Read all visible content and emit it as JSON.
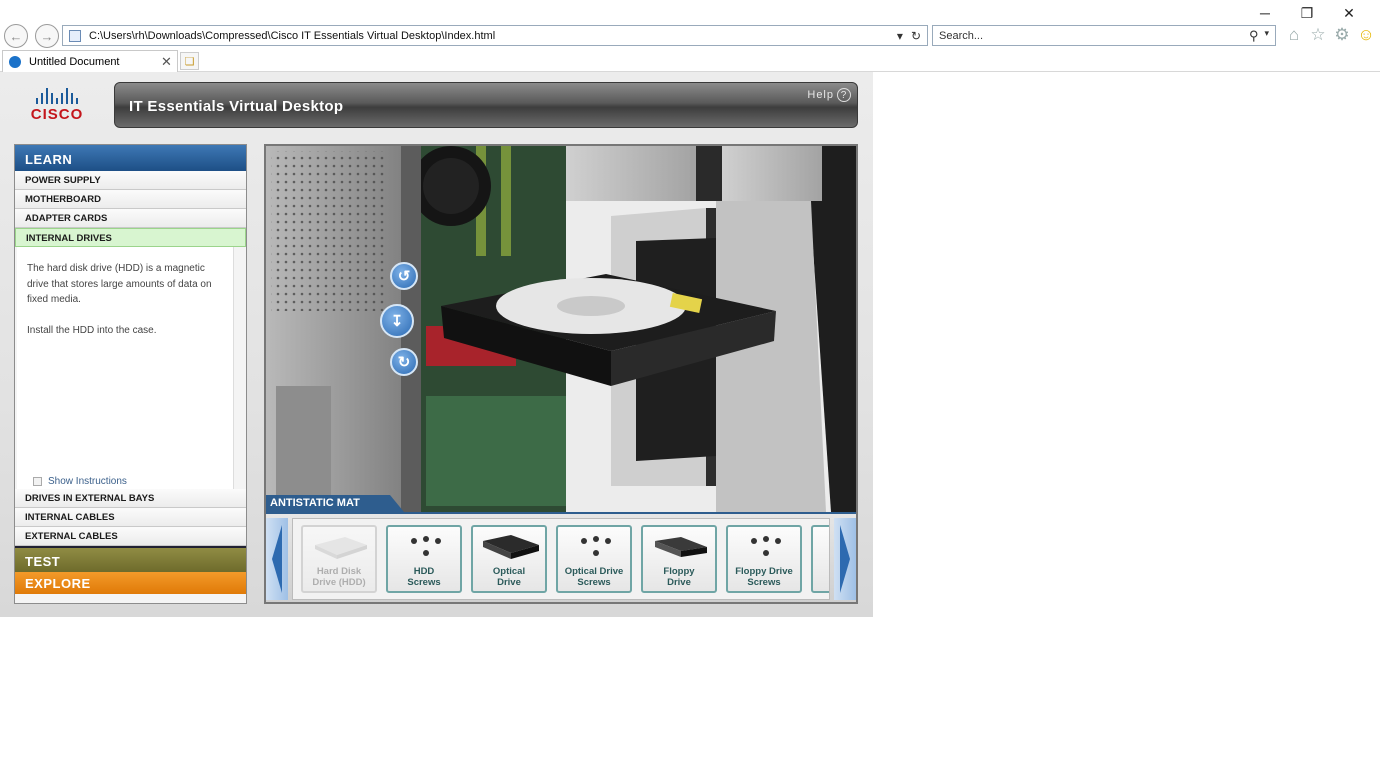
{
  "browser": {
    "window_controls": {
      "minimize": "─",
      "restore": "❐",
      "close": "✕"
    },
    "address": "C:\\Users\\rh\\Downloads\\Compressed\\Cisco IT Essentials Virtual Desktop\\Index.html",
    "search_placeholder": "Search...",
    "tab_title": "Untitled Document",
    "icons": {
      "back": "back-arrow-icon",
      "forward": "forward-arrow-icon",
      "home": "home-icon",
      "favorites": "star-icon",
      "settings": "gear-icon",
      "feedback": "smiley-icon"
    }
  },
  "app": {
    "logo_text": "CISCO",
    "title": "IT Essentials Virtual Desktop",
    "help": "Help",
    "menu": {
      "learn": "LEARN",
      "items_top": [
        "POWER SUPPLY",
        "MOTHERBOARD",
        "ADAPTER CARDS"
      ],
      "active": "INTERNAL DRIVES",
      "description": "The hard disk drive (HDD) is a magnetic drive that stores large amounts of data on fixed media.",
      "instruction": "Install the HDD into the case.",
      "show_instructions": "Show Instructions",
      "items_bottom": [
        "DRIVES IN EXTERNAL BAYS",
        "INTERNAL CABLES",
        "EXTERNAL CABLES"
      ],
      "test": "TEST",
      "explore": "EXPLORE"
    },
    "viewport": {
      "mat_label": "ANTISTATIC MAT",
      "tray_items": [
        {
          "line1": "Hard Disk",
          "line2": "Drive (HDD)"
        },
        {
          "line1": "HDD",
          "line2": "Screws"
        },
        {
          "line1": "Optical",
          "line2": "Drive"
        },
        {
          "line1": "Optical Drive",
          "line2": "Screws"
        },
        {
          "line1": "Floppy",
          "line2": "Drive"
        },
        {
          "line1": "Floppy Drive",
          "line2": "Screws"
        }
      ]
    },
    "colors": {
      "learn_blue": "#1d4f86",
      "test_olive": "#6e6b2c",
      "explore_orange": "#e07a07",
      "active_green": "#d8f5d0"
    }
  }
}
